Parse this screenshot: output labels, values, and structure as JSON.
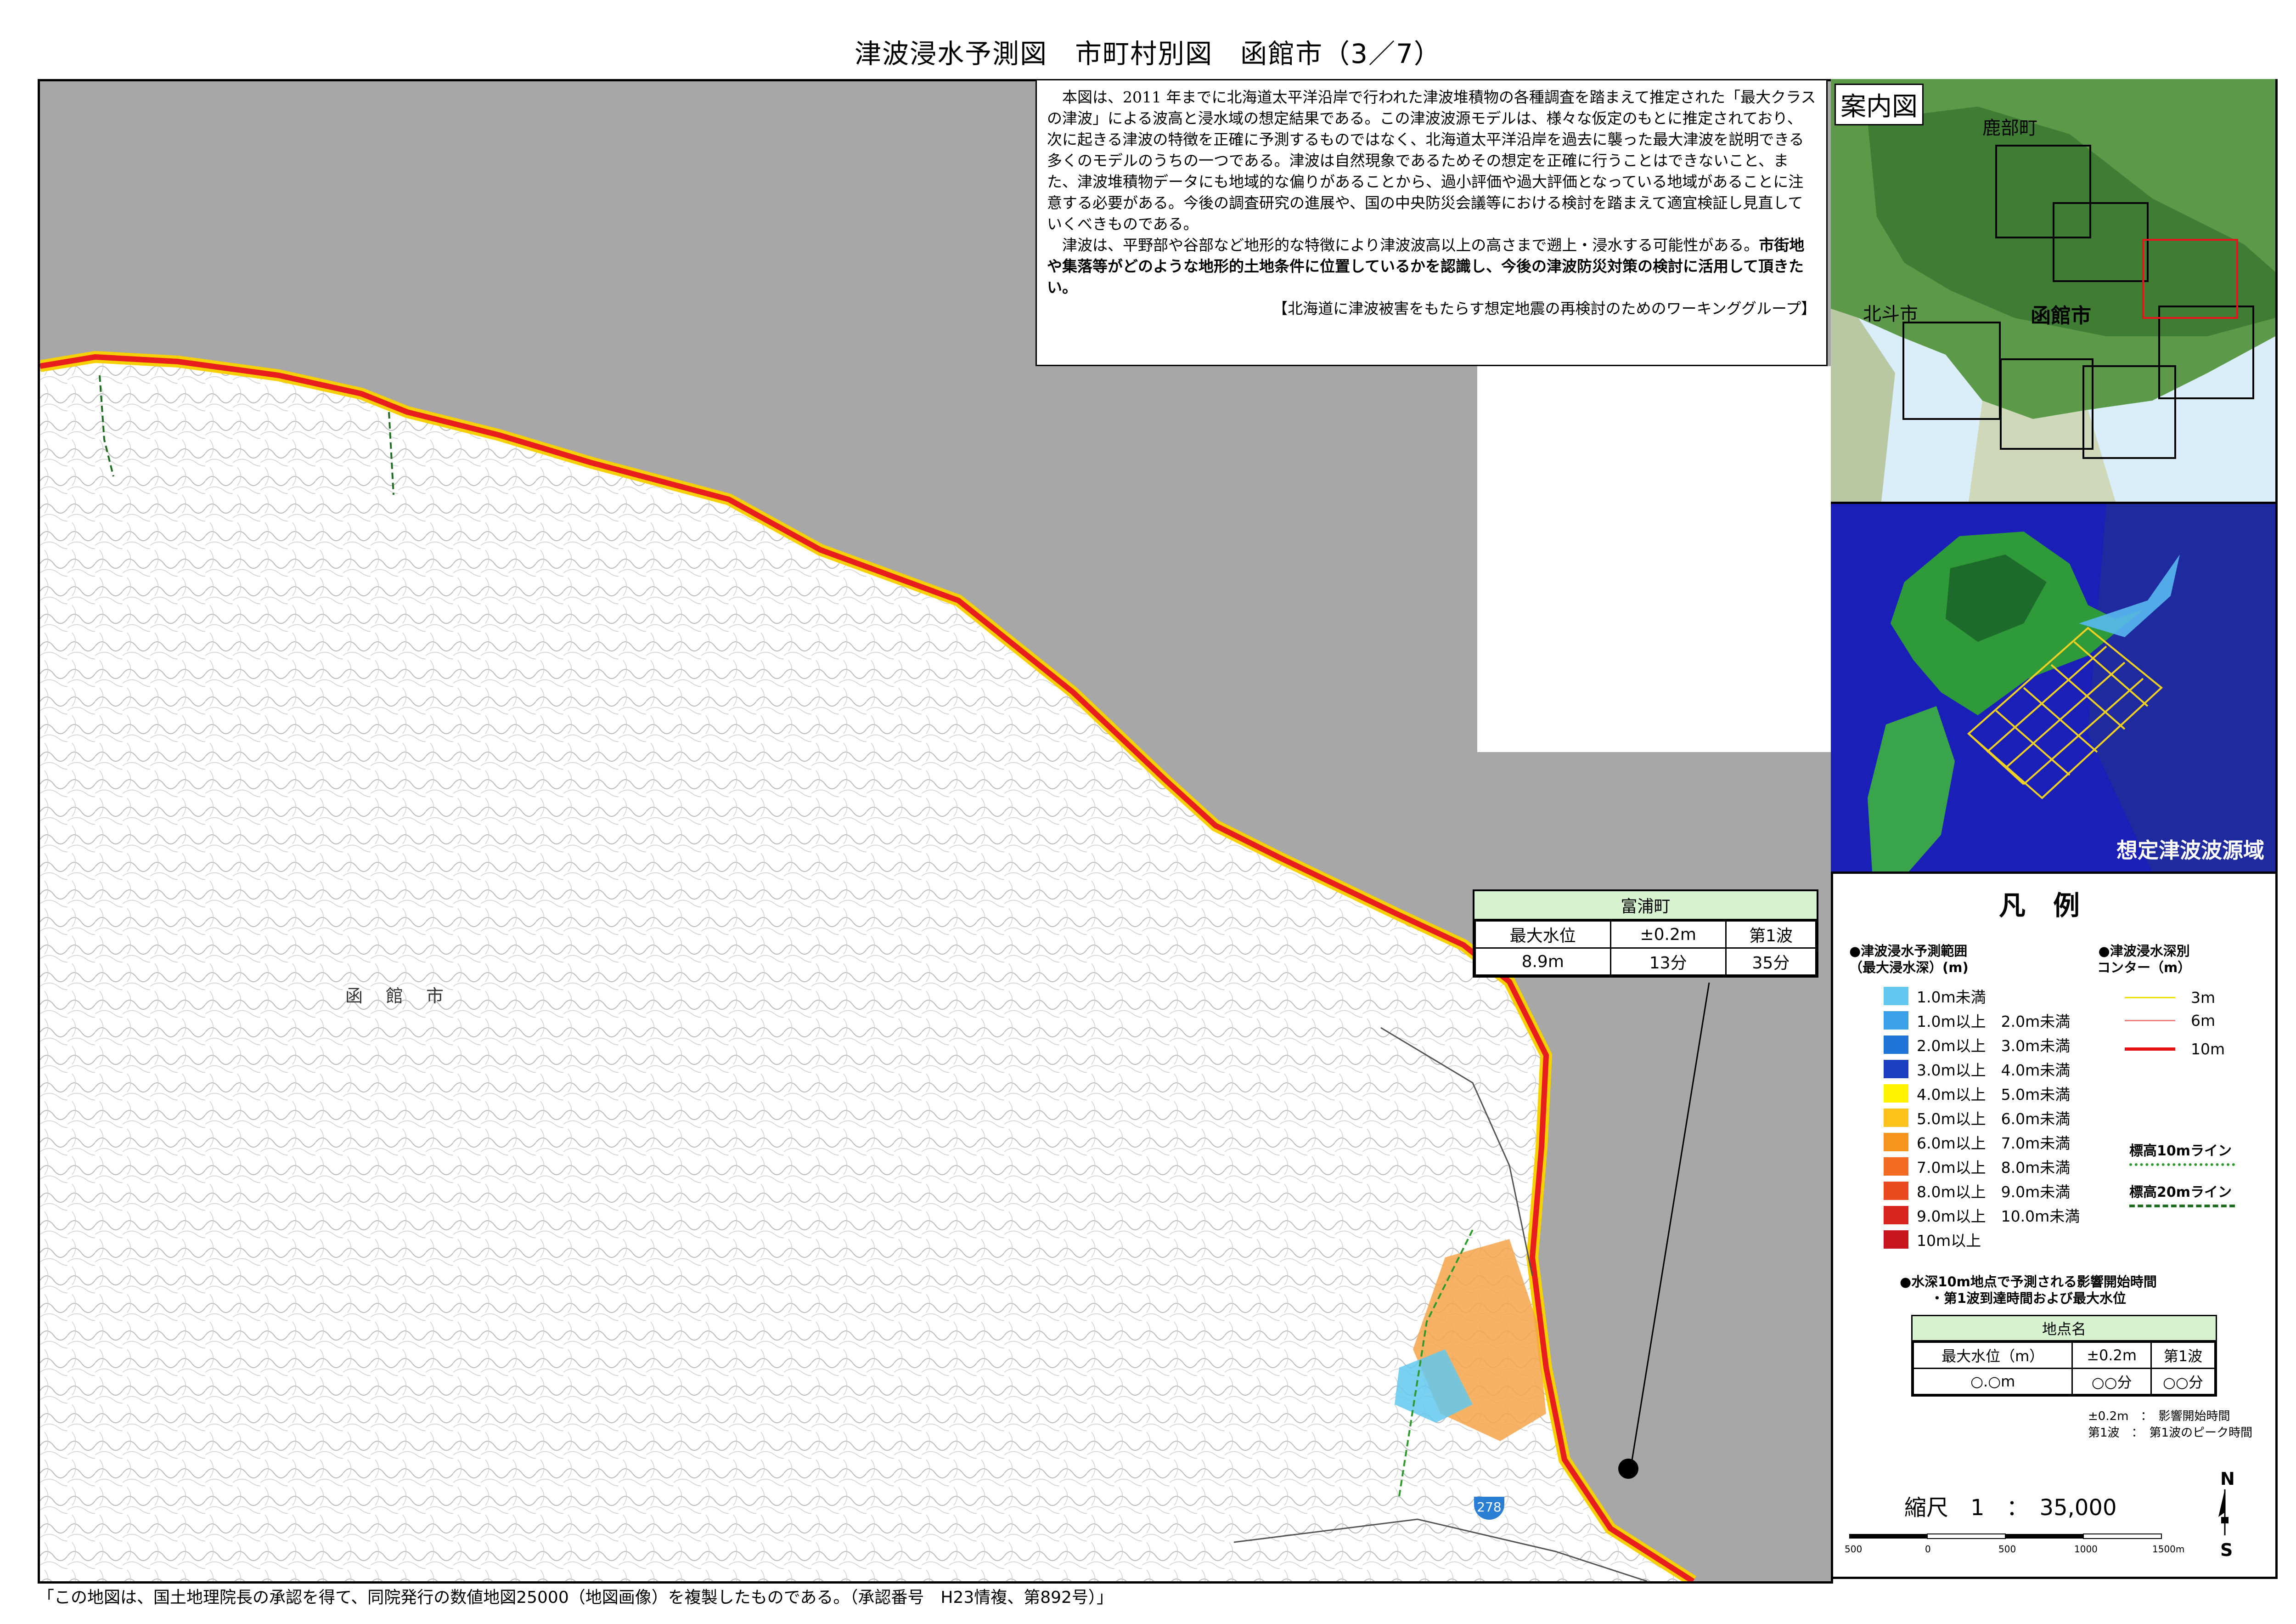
{
  "title": "津波浸水予測図　市町村別図　函館市（3／7）",
  "notice": {
    "paragraph1": "本図は、2011 年までに北海道太平洋沿岸で行われた津波堆積物の各種調査を踏まえて推定された「最大クラスの津波」による波高と浸水域の想定結果である。この津波波源モデルは、様々な仮定のもとに推定されており、次に起きる津波の特徴を正確に予測するものではなく、北海道太平洋沿岸を過去に襲った最大津波を説明できる多くのモデルのうちの一つである。津波は自然現象であるためその想定を正確に行うことはできないこと、また、津波堆積物データにも地域的な偏りがあることから、過小評価や過大評価となっている地域があることに注意する必要がある。今後の調査研究の進展や、国の中央防災会議等における検討を踏まえて適宜検証し見直していくべきものである。",
    "paragraph2_plain": "津波は、平野部や谷部など地形的な特徴により津波波高以上の高さまで遡上・浸水する可能性がある。",
    "paragraph2_bold": "市街地や集落等がどのような地形的土地条件に位置しているかを認識し、今後の津波防災対策の検討に活用して頂きたい。",
    "credit": "【北海道に津波被害をもたらす想定地震の再検討のためのワーキンググループ】"
  },
  "station": {
    "name": "富浦町",
    "headers": [
      "最大水位",
      "±0.2m",
      "第1波"
    ],
    "values": [
      "8.9m",
      "13分",
      "35分"
    ]
  },
  "map_labels": {
    "city": "函館市",
    "route": "278"
  },
  "guide_map": {
    "title": "案内図",
    "labels": {
      "north_town": "鹿部町",
      "west_city": "北斗市",
      "city": "函館市"
    }
  },
  "source_map": {
    "title": "想定津波波源域"
  },
  "legend": {
    "title": "凡例",
    "inundation_head": "●津波浸水予測範囲\n（最大浸水深）(m)",
    "depth_classes": [
      {
        "label": "1.0m未満",
        "color": "#62c8ef"
      },
      {
        "label": "1.0m以上　2.0m未満",
        "color": "#3aa0e8"
      },
      {
        "label": "2.0m以上　3.0m未満",
        "color": "#1f74d8"
      },
      {
        "label": "3.0m以上　4.0m未満",
        "color": "#1a3ec2"
      },
      {
        "label": "4.0m以上　5.0m未満",
        "color": "#fff200"
      },
      {
        "label": "5.0m以上　6.0m未満",
        "color": "#ffc21c"
      },
      {
        "label": "6.0m以上　7.0m未満",
        "color": "#f7941d"
      },
      {
        "label": "7.0m以上　8.0m未満",
        "color": "#f26b21"
      },
      {
        "label": "8.0m以上　9.0m未満",
        "color": "#e8491d"
      },
      {
        "label": "9.0m以上　10.0m未満",
        "color": "#d8251d"
      },
      {
        "label": "10m以上",
        "color": "#c8141d"
      }
    ],
    "contour_head": "●津波浸水深別\nコンター（m）",
    "contours": [
      {
        "label": "3m",
        "color": "#f0e000"
      },
      {
        "label": "6m",
        "color": "#f08080"
      },
      {
        "label": "10m",
        "color": "#e81010"
      }
    ],
    "elevation_lines": [
      {
        "label": "標高10mライン",
        "color": "#2e9a2e"
      },
      {
        "label": "標高20mライン",
        "color": "#1f6e1f"
      }
    ],
    "arrival_head": "●水深10m地点で予測される影響開始時間\n・第1波到達時間および最大水位",
    "sample": {
      "name": "地点名",
      "headers": [
        "最大水位（m）",
        "±0.2m",
        "第1波"
      ],
      "values": [
        "○.○m",
        "○○分",
        "○○分"
      ]
    },
    "notes": [
      "±0.2m　：　影響開始時間",
      "第1波　：　第1波のピーク時間"
    ],
    "scale_text": "縮尺　1　：　35,000",
    "scale_ticks": [
      "500",
      "0",
      "500",
      "1000",
      "1500m"
    ],
    "north_n": "N",
    "north_s": "S"
  },
  "footer": "「この地図は、国土地理院長の承認を得て、同院発行の数値地図25000（地図画像）を複製したものである。（承認番号　H23情複、第892号）」"
}
